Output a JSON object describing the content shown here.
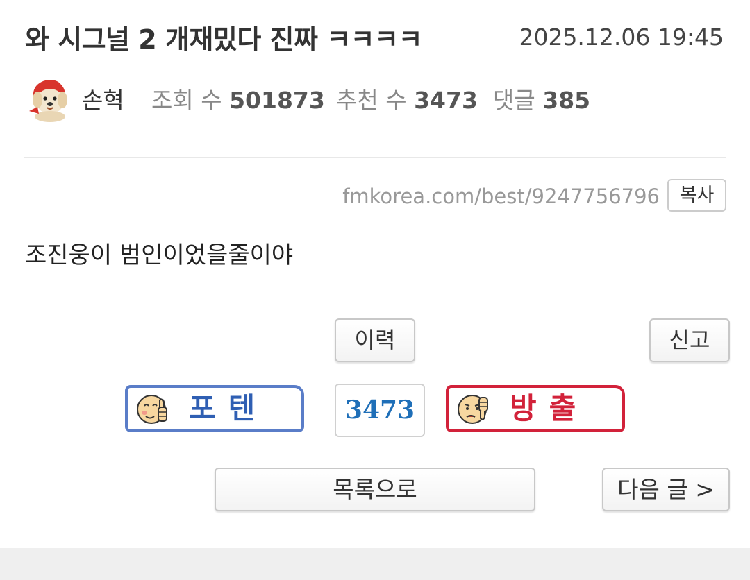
{
  "post": {
    "title": "와 시그널 2 개재밌다 진짜 ㅋㅋㅋㅋ",
    "date": "2025.12.06 19:45",
    "author": "손혁",
    "stats": {
      "views_label": "조회 수",
      "views": "501873",
      "recommend_label": "추천 수",
      "recommend": "3473",
      "comments_label": "댓글",
      "comments": "385"
    },
    "url": "fmkorea.com/best/9247756796",
    "copy_label": "복사",
    "body": "조진웅이 범인이었을줄이야"
  },
  "actions": {
    "history_label": "이력",
    "report_label": "신고",
    "upvote_label": "포텐",
    "downvote_label": "방출",
    "vote_count": "3473",
    "list_label": "목록으로",
    "next_label": "다음 글 >"
  },
  "icons": {
    "avatar": "puppy-avatar-icon",
    "upvote": "thumbs-up-face-icon",
    "downvote": "thumbs-down-face-icon"
  },
  "colors": {
    "upvote": "#5a7dc8",
    "downvote": "#d2223a",
    "vote_count": "#1f6fb8"
  }
}
